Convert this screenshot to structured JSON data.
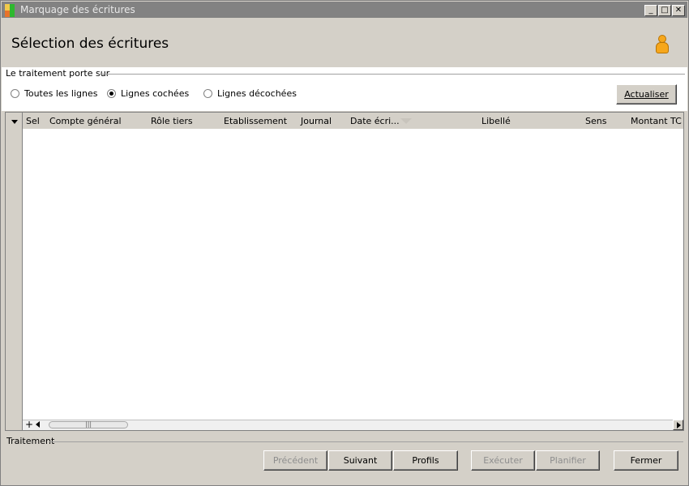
{
  "window": {
    "title": "Marquage des écritures",
    "minimize_label": "_",
    "maximize_label": "□",
    "close_label": "✕"
  },
  "header": {
    "title": "Sélection des écritures",
    "user_icon": "person-icon"
  },
  "filter": {
    "group_label": "Le traitement porte sur",
    "options": [
      {
        "label": "Toutes les lignes",
        "selected": false
      },
      {
        "label": "Lignes cochées",
        "selected": true
      },
      {
        "label": "Lignes décochées",
        "selected": false
      }
    ],
    "refresh_label": "Actualiser",
    "refresh_mnemonic": "A"
  },
  "grid": {
    "columns": [
      "Sel",
      "Compte général",
      "Rôle tiers",
      "Etablissement",
      "Journal",
      "Date écri...",
      "Libellé",
      "Sens",
      "Montant TC"
    ],
    "sorted_column": "Date écri...",
    "rows": [],
    "add_row_label": "+",
    "scroll_grip": "|||"
  },
  "footer": {
    "group_label": "Traitement",
    "buttons": [
      {
        "label": "Précédent",
        "enabled": false
      },
      {
        "label": "Suivant",
        "enabled": true
      },
      {
        "label": "Profils",
        "enabled": true
      },
      {
        "label": "Exécuter",
        "enabled": false
      },
      {
        "label": "Planifier",
        "enabled": false
      },
      {
        "label": "Fermer",
        "enabled": true
      }
    ]
  },
  "colors": {
    "titlebar": "#828282",
    "background": "#d4d0c8",
    "panel": "#ffffff",
    "user_icon": "#f6a71c"
  }
}
